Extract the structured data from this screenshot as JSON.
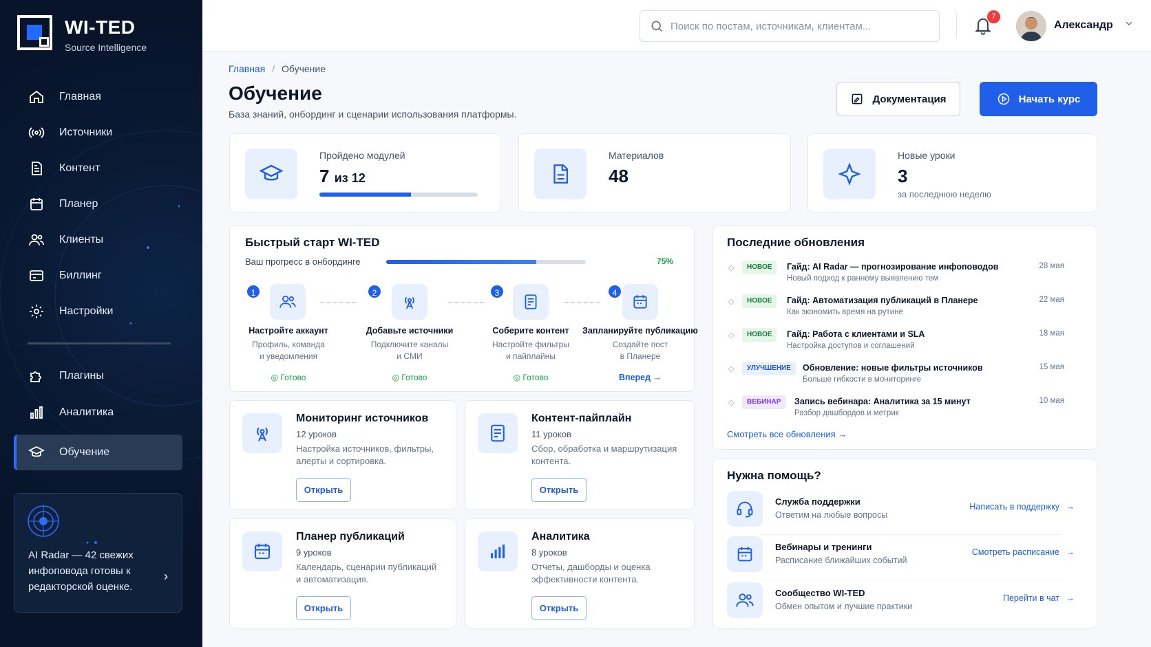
{
  "brand": {
    "name": "WI-TED",
    "subtitle": "Source Intelligence"
  },
  "sidebar": {
    "items": [
      {
        "label": "Главная",
        "icon": "home-icon"
      },
      {
        "label": "Источники",
        "icon": "broadcast-icon"
      },
      {
        "label": "Контент",
        "icon": "document-icon"
      },
      {
        "label": "Планер",
        "icon": "calendar-icon"
      },
      {
        "label": "Клиенты",
        "icon": "users-icon"
      },
      {
        "label": "Биллинг",
        "icon": "card-icon"
      },
      {
        "label": "Настройки",
        "icon": "gear-icon"
      },
      {
        "label": "Плагины",
        "icon": "puzzle-icon"
      },
      {
        "label": "Аналитика",
        "icon": "bar-chart-icon"
      },
      {
        "label": "Обучение",
        "icon": "graduation-cap-icon",
        "active": true
      }
    ],
    "radar": {
      "text": "AI Radar — 42 свежих инфоповода готовы к редакторской оценке."
    }
  },
  "header": {
    "search_placeholder": "Поиск по постам, источникам, клиентам...",
    "notifications": "7",
    "user": "Александр"
  },
  "page": {
    "breadcrumb_home": "Главная",
    "breadcrumb_sep": "/",
    "breadcrumb_current": "Обучение",
    "title": "Обучение",
    "subtitle": "База знаний, онбординг и сценарии использования платформы.",
    "btn_docs": "Документация",
    "btn_start": "Начать курс"
  },
  "stats": {
    "modules": {
      "label": "Пройдено модулей",
      "value": "7",
      "suffix": "из 12",
      "progress": 0.58
    },
    "materials": {
      "label": "Материалов",
      "value": "48"
    },
    "lessons": {
      "label": "Новые уроки",
      "value": "3",
      "note": "за последнюю неделю"
    }
  },
  "quickstart": {
    "title": "Быстрый старт WI-TED",
    "progress_label": "Ваш прогресс в онбординге",
    "progress_value": "75%",
    "progress": 0.75,
    "steps": [
      {
        "num": "1",
        "title": "Настройте аккаунт",
        "desc1": "Профиль, команда",
        "desc2": "и уведомления",
        "status": "Готово"
      },
      {
        "num": "2",
        "title": "Добавьте источники",
        "desc1": "Подключите каналы",
        "desc2": "и СМИ",
        "status": "Готово"
      },
      {
        "num": "3",
        "title": "Соберите контент",
        "desc1": "Настройте фильтры",
        "desc2": "и пайплайны",
        "status": "Готово"
      },
      {
        "num": "4",
        "title": "Запланируйте публикацию",
        "desc1": "Создайте пост",
        "desc2": "в Планере",
        "status": "Вперед"
      }
    ]
  },
  "modules": [
    {
      "title": "Мониторинг источников",
      "count": "12 уроков",
      "desc1": "Настройка источников, фильтры,",
      "desc2": "алерты и сортировка.",
      "btn": "Открыть"
    },
    {
      "title": "Контент-пайплайн",
      "count": "11 уроков",
      "desc1": "Сбор, обработка и маршрутизация",
      "desc2": "контента.",
      "btn": "Открыть"
    },
    {
      "title": "Планер публикаций",
      "count": "9 уроков",
      "desc1": "Календарь, сценарии публикаций",
      "desc2": "и автоматизация.",
      "btn": "Открыть"
    },
    {
      "title": "Аналитика",
      "count": "8 уроков",
      "desc1": "Отчеты, дашборды и оценка",
      "desc2": "эффективности контента.",
      "btn": "Открыть"
    }
  ],
  "updates": {
    "title": "Последние обновления",
    "items": [
      {
        "tag": "НОВОЕ",
        "title": "Гайд: AI Radar — прогнозирование инфоповодов",
        "desc": "Новый подход к раннему выявлению тем",
        "date": "28 мая"
      },
      {
        "tag": "НОВОЕ",
        "title": "Гайд: Автоматизация публикаций в Планере",
        "desc": "Как экономить время на рутине",
        "date": "22 мая"
      },
      {
        "tag": "НОВОЕ",
        "title": "Гайд: Работа с клиентами и SLA",
        "desc": "Настройка доступов и соглашений",
        "date": "18 мая"
      },
      {
        "tag": "УЛУЧШЕНИЕ",
        "title": "Обновление: новые фильтры источников",
        "desc": "Больше гибкости в мониторинге",
        "date": "15 мая"
      },
      {
        "tag": "ВЕБИНАР",
        "title": "Запись вебинара: Аналитика за 15 минут",
        "desc": "Разбор дашбордов и метрик",
        "date": "10 мая"
      }
    ],
    "see_all": "Смотреть все обновления"
  },
  "help": {
    "title": "Нужна помощь?",
    "items": [
      {
        "title": "Служба поддержки",
        "desc": "Ответим на любые вопросы",
        "link": "Написать в поддержку"
      },
      {
        "title": "Вебинары и тренинги",
        "desc": "Расписание ближайших событий",
        "link": "Смотреть расписание"
      },
      {
        "title": "Сообщество WI-TED",
        "desc": "Обмен опытом и лучшие практики",
        "link": "Перейти в чат"
      }
    ]
  },
  "colors": {
    "accent": "#1f5fea",
    "sidebar_bg": "#07142a",
    "success": "#16a34a"
  }
}
